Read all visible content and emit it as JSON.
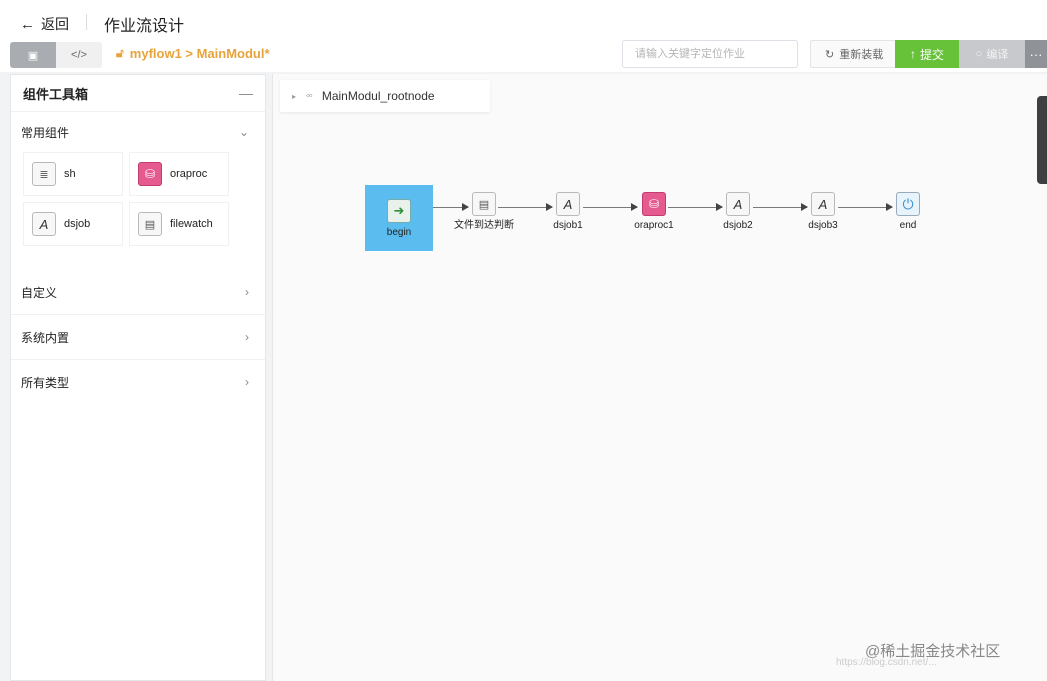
{
  "header": {
    "back_label": "返回",
    "title": "作业流设计"
  },
  "toolbar": {
    "view_icons": [
      "image-icon",
      "code-icon"
    ],
    "breadcrumb": "myflow1 > MainModul*",
    "search_placeholder": "请输入关键字定位作业",
    "reload_label": "重新装载",
    "submit_label": "提交",
    "compile_label": "编译",
    "more_label": "···"
  },
  "toolbox": {
    "title": "组件工具箱",
    "collapse_icon": "—",
    "sections": [
      {
        "label": "常用组件",
        "expanded": true
      },
      {
        "label": "自定义",
        "expanded": false
      },
      {
        "label": "系统内置",
        "expanded": false
      },
      {
        "label": "所有类型",
        "expanded": false
      }
    ],
    "components": [
      {
        "label": "sh",
        "icon": "script-icon"
      },
      {
        "label": "oraproc",
        "icon": "database-icon"
      },
      {
        "label": "dsjob",
        "icon": "datastage-job-icon"
      },
      {
        "label": "filewatch",
        "icon": "file-watch-icon"
      }
    ]
  },
  "canvas": {
    "root_node": "MainModul_rootnode",
    "nodes": [
      {
        "label": "begin",
        "icon": "arrow-right-icon",
        "selected": true
      },
      {
        "label": "文件到达判断",
        "icon": "file-check-icon"
      },
      {
        "label": "dsjob1",
        "icon": "datastage-job-icon"
      },
      {
        "label": "oraproc1",
        "icon": "database-icon"
      },
      {
        "label": "dsjob2",
        "icon": "datastage-job-icon"
      },
      {
        "label": "dsjob3",
        "icon": "datastage-job-icon"
      },
      {
        "label": "end",
        "icon": "power-icon"
      }
    ]
  },
  "watermark": {
    "text": "@稀土掘金技术社区",
    "url": "https://blog.csdn.net/..."
  },
  "colors": {
    "submit": "#67c23a",
    "selected_node": "#5bbcf0",
    "breadcrumb": "#e8a33a"
  }
}
